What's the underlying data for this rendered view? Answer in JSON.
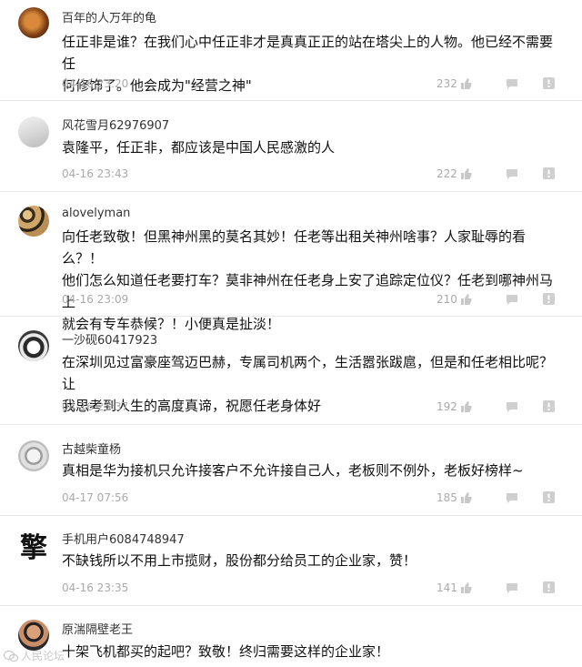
{
  "comments": [
    {
      "user": "百年的人万年的龟",
      "lines": [
        "任正非是谁？在我们心中任正非才是真真正正的站在塔尖上的人物。他已经不需要任",
        "何修饰了。他会成为\"经营之神\""
      ],
      "time": "04-16 23:20",
      "likes": "232"
    },
    {
      "user": "风花雪月62976907",
      "lines": [
        "袁隆平，任正非，都应该是中国人民感激的人"
      ],
      "time": "04-16 23:43",
      "likes": "222"
    },
    {
      "user": "alovelyman",
      "lines": [
        "向任老致敬！但黑神州黑的莫名其妙！任老等出租关神州啥事？人家耻辱的看么？！",
        "他们怎么知道任老要打车？莫非神州在任老身上安了追踪定位仪？任老到哪神州马上",
        "就会有专车恭候？！小便真是扯淡！"
      ],
      "time": "04-16 23:09",
      "likes": "210"
    },
    {
      "user": "一沙砚60417923",
      "lines": [
        "在深圳见过富豪座驾迈巴赫，专属司机两个，生活嚣张跋扈，但是和任老相比呢？让",
        "我思考到人生的高度真谛，祝愿任老身体好"
      ],
      "time": "04-16 23:37",
      "likes": "192"
    },
    {
      "user": "古越柴童杨",
      "lines": [
        "真相是华为接机只允许接客户不允许接自己人，老板则不例外，老板好榜样~"
      ],
      "time": "04-17 07:56",
      "likes": "185"
    },
    {
      "user": "手机用户6084748947",
      "lines": [
        "不缺钱所以不用上市揽财，股份都分给员工的企业家，赞！"
      ],
      "time": "04-16 23:35",
      "likes": "141"
    },
    {
      "user": "原湍隔壁老王",
      "lines": [
        "十架飞机都买的起吧？致敬！终归需要这样的企业家！"
      ]
    }
  ],
  "watermark": "人民论坛",
  "avatar_glyph": "擎",
  "colors": {
    "text": "#111111",
    "meta": "#aaaaaa",
    "divider": "#e9e9e9"
  }
}
